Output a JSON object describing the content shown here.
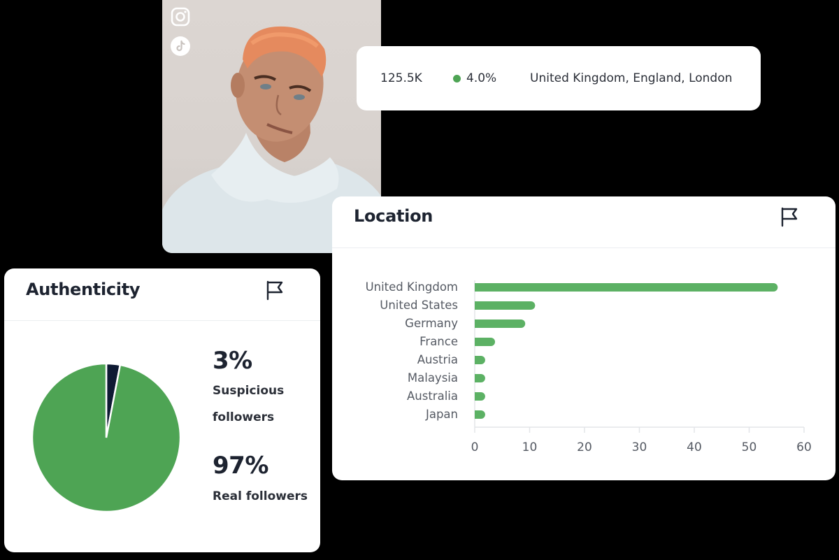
{
  "profile": {
    "photo_alt": "Influencer portrait with orange hair wearing light blue hoodie",
    "platforms": [
      {
        "name": "Instagram",
        "icon": "instagram-icon"
      },
      {
        "name": "TikTok",
        "icon": "tiktok-icon"
      }
    ]
  },
  "stats": {
    "followers": "125.5K",
    "engagement_rate": "4.0%",
    "engagement_status_color": "#4ea454",
    "location": "United Kingdom, England, London"
  },
  "location_card": {
    "title": "Location",
    "flag_icon": "flag-icon"
  },
  "authenticity_card": {
    "title": "Authenticity",
    "flag_icon": "flag-icon",
    "suspicious_value": "3%",
    "suspicious_label": "Suspicious followers",
    "real_value": "97%",
    "real_label": "Real followers"
  },
  "colors": {
    "bar": "#5cb164",
    "pie_real": "#4ea454",
    "pie_suspicious": "#0e1a33",
    "axis": "#e3e5e8",
    "tick_text": "#555a63"
  },
  "chart_data": [
    {
      "type": "bar",
      "orientation": "horizontal",
      "title": "Location",
      "categories": [
        "United Kingdom",
        "United States",
        "Germany",
        "France",
        "Austria",
        "Malaysia",
        "Australia",
        "Japan"
      ],
      "values": [
        55.2,
        11.0,
        9.2,
        3.7,
        1.9,
        1.9,
        1.9,
        1.9
      ],
      "xlim": [
        0,
        60
      ],
      "xticks": [
        0,
        10,
        20,
        30,
        40,
        50,
        60
      ],
      "xlabel": "",
      "ylabel": "",
      "grid": false
    },
    {
      "type": "pie",
      "title": "Authenticity",
      "labels": [
        "Suspicious followers",
        "Real followers"
      ],
      "values": [
        3,
        97
      ],
      "start_angle": "top",
      "direction": "clockwise"
    }
  ]
}
